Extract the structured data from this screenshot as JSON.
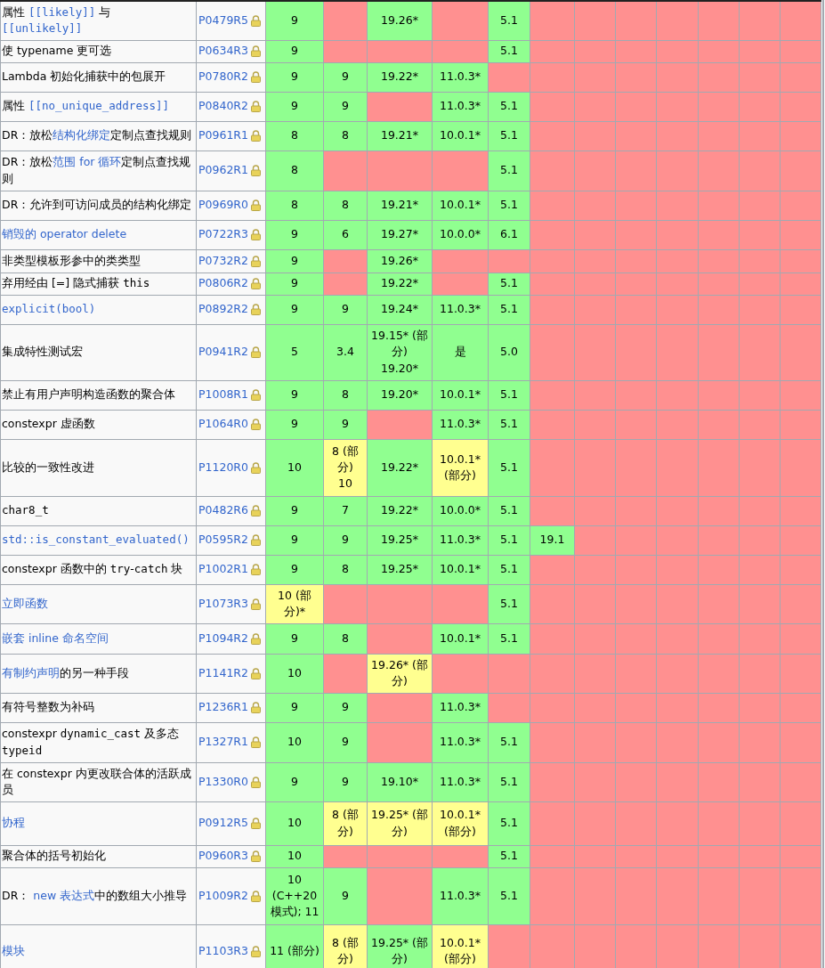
{
  "rows": [
    {
      "feature": [
        {
          "kind": "plain",
          "text": "属性 "
        },
        {
          "kind": "link-code",
          "text": "[[likely]]"
        },
        {
          "kind": "plain",
          "text": " 与 "
        },
        {
          "kind": "link-code",
          "text": "[[unlikely]]"
        }
      ],
      "paper": "P0479R5",
      "cells": [
        {
          "supported": true,
          "text": "9"
        },
        {
          "supported": false,
          "partial": false
        },
        {
          "supported": true,
          "text": "19.26*"
        },
        {
          "supported": false,
          "partial": false
        },
        {
          "supported": true,
          "text": "5.1"
        },
        {
          "supported": false,
          "partial": false
        },
        {
          "supported": false,
          "partial": false
        },
        {
          "supported": false,
          "partial": false
        },
        {
          "supported": false,
          "partial": false
        },
        {
          "supported": false,
          "partial": false
        },
        {
          "supported": false,
          "partial": false
        },
        {
          "supported": false,
          "partial": false
        }
      ]
    },
    {
      "feature": [
        {
          "kind": "plain",
          "text": "使 typename 更可选"
        }
      ],
      "paper": "P0634R3",
      "cells": [
        {
          "supported": true,
          "text": "9"
        },
        {
          "supported": false,
          "partial": false
        },
        {
          "supported": false,
          "partial": false
        },
        {
          "supported": false,
          "partial": false
        },
        {
          "supported": true,
          "text": "5.1"
        },
        {
          "supported": false,
          "partial": false
        },
        {
          "supported": false,
          "partial": false
        },
        {
          "supported": false,
          "partial": false
        },
        {
          "supported": false,
          "partial": false
        },
        {
          "supported": false,
          "partial": false
        },
        {
          "supported": false,
          "partial": false
        },
        {
          "supported": false,
          "partial": false
        }
      ]
    },
    {
      "feature": [
        {
          "kind": "plain",
          "text": "Lambda 初始化捕获中的包展开"
        }
      ],
      "paper": "P0780R2",
      "cells": [
        {
          "supported": true,
          "text": "9"
        },
        {
          "supported": true,
          "text": "9"
        },
        {
          "supported": true,
          "text": "19.22*"
        },
        {
          "supported": true,
          "text": "11.0.3*"
        },
        {
          "supported": false,
          "partial": false
        },
        {
          "supported": false,
          "partial": false
        },
        {
          "supported": false,
          "partial": false
        },
        {
          "supported": false,
          "partial": false
        },
        {
          "supported": false,
          "partial": false
        },
        {
          "supported": false,
          "partial": false
        },
        {
          "supported": false,
          "partial": false
        },
        {
          "supported": false,
          "partial": false
        }
      ]
    },
    {
      "feature": [
        {
          "kind": "plain",
          "text": "属性 "
        },
        {
          "kind": "link-code",
          "text": "[[no_unique_address]]"
        }
      ],
      "paper": "P0840R2",
      "cells": [
        {
          "supported": true,
          "text": "9"
        },
        {
          "supported": true,
          "text": "9"
        },
        {
          "supported": false,
          "partial": false
        },
        {
          "supported": true,
          "text": "11.0.3*"
        },
        {
          "supported": true,
          "text": "5.1"
        },
        {
          "supported": false,
          "partial": false
        },
        {
          "supported": false,
          "partial": false
        },
        {
          "supported": false,
          "partial": false
        },
        {
          "supported": false,
          "partial": false
        },
        {
          "supported": false,
          "partial": false
        },
        {
          "supported": false,
          "partial": false
        },
        {
          "supported": false,
          "partial": false
        }
      ]
    },
    {
      "feature": [
        {
          "kind": "plain",
          "text": "DR：放松"
        },
        {
          "kind": "link",
          "text": "结构化绑定"
        },
        {
          "kind": "plain",
          "text": "定制点查找规则"
        }
      ],
      "paper": "P0961R1",
      "cells": [
        {
          "supported": true,
          "text": "8"
        },
        {
          "supported": true,
          "text": "8"
        },
        {
          "supported": true,
          "text": "19.21*"
        },
        {
          "supported": true,
          "text": "10.0.1*"
        },
        {
          "supported": true,
          "text": "5.1"
        },
        {
          "supported": false,
          "partial": false
        },
        {
          "supported": false,
          "partial": false
        },
        {
          "supported": false,
          "partial": false
        },
        {
          "supported": false,
          "partial": false
        },
        {
          "supported": false,
          "partial": false
        },
        {
          "supported": false,
          "partial": false
        },
        {
          "supported": false,
          "partial": false
        }
      ]
    },
    {
      "feature": [
        {
          "kind": "plain",
          "text": "DR：放松"
        },
        {
          "kind": "link",
          "text": "范围 for 循环"
        },
        {
          "kind": "plain",
          "text": "定制点查找规则"
        }
      ],
      "paper": "P0962R1",
      "cells": [
        {
          "supported": true,
          "text": "8"
        },
        {
          "supported": false,
          "partial": false
        },
        {
          "supported": false,
          "partial": false
        },
        {
          "supported": false,
          "partial": false
        },
        {
          "supported": true,
          "text": "5.1"
        },
        {
          "supported": false,
          "partial": false
        },
        {
          "supported": false,
          "partial": false
        },
        {
          "supported": false,
          "partial": false
        },
        {
          "supported": false,
          "partial": false
        },
        {
          "supported": false,
          "partial": false
        },
        {
          "supported": false,
          "partial": false
        },
        {
          "supported": false,
          "partial": false
        }
      ]
    },
    {
      "feature": [
        {
          "kind": "plain",
          "text": "DR：允许到可访问成员的结构化绑定"
        }
      ],
      "paper": "P0969R0",
      "cells": [
        {
          "supported": true,
          "text": "8"
        },
        {
          "supported": true,
          "text": "8"
        },
        {
          "supported": true,
          "text": "19.21*"
        },
        {
          "supported": true,
          "text": "10.0.1*"
        },
        {
          "supported": true,
          "text": "5.1"
        },
        {
          "supported": false,
          "partial": false
        },
        {
          "supported": false,
          "partial": false
        },
        {
          "supported": false,
          "partial": false
        },
        {
          "supported": false,
          "partial": false
        },
        {
          "supported": false,
          "partial": false
        },
        {
          "supported": false,
          "partial": false
        },
        {
          "supported": false,
          "partial": false
        }
      ]
    },
    {
      "feature": [
        {
          "kind": "link",
          "text": "销毁的 operator delete"
        }
      ],
      "paper": "P0722R3",
      "cells": [
        {
          "supported": true,
          "text": "9"
        },
        {
          "supported": true,
          "text": "6"
        },
        {
          "supported": true,
          "text": "19.27*"
        },
        {
          "supported": true,
          "text": "10.0.0*"
        },
        {
          "supported": true,
          "text": "6.1"
        },
        {
          "supported": false,
          "partial": false
        },
        {
          "supported": false,
          "partial": false
        },
        {
          "supported": false,
          "partial": false
        },
        {
          "supported": false,
          "partial": false
        },
        {
          "supported": false,
          "partial": false
        },
        {
          "supported": false,
          "partial": false
        },
        {
          "supported": false,
          "partial": false
        }
      ]
    },
    {
      "feature": [
        {
          "kind": "plain",
          "text": "非类型模板形参中的类类型"
        }
      ],
      "paper": "P0732R2",
      "cells": [
        {
          "supported": true,
          "text": "9"
        },
        {
          "supported": false,
          "partial": false
        },
        {
          "supported": true,
          "text": "19.26*"
        },
        {
          "supported": false,
          "partial": false
        },
        {
          "supported": false,
          "partial": false
        },
        {
          "supported": false,
          "partial": false
        },
        {
          "supported": false,
          "partial": false
        },
        {
          "supported": false,
          "partial": false
        },
        {
          "supported": false,
          "partial": false
        },
        {
          "supported": false,
          "partial": false
        },
        {
          "supported": false,
          "partial": false
        },
        {
          "supported": false,
          "partial": false
        }
      ]
    },
    {
      "feature": [
        {
          "kind": "plain",
          "text": "弃用经由 [=] 隐式捕获 "
        },
        {
          "kind": "code",
          "text": "this"
        }
      ],
      "paper": "P0806R2",
      "cells": [
        {
          "supported": true,
          "text": "9"
        },
        {
          "supported": false,
          "partial": false
        },
        {
          "supported": true,
          "text": "19.22*"
        },
        {
          "supported": false,
          "partial": false
        },
        {
          "supported": true,
          "text": "5.1"
        },
        {
          "supported": false,
          "partial": false
        },
        {
          "supported": false,
          "partial": false
        },
        {
          "supported": false,
          "partial": false
        },
        {
          "supported": false,
          "partial": false
        },
        {
          "supported": false,
          "partial": false
        },
        {
          "supported": false,
          "partial": false
        },
        {
          "supported": false,
          "partial": false
        }
      ]
    },
    {
      "feature": [
        {
          "kind": "link-code",
          "text": "explicit(bool)"
        }
      ],
      "paper": "P0892R2",
      "cells": [
        {
          "supported": true,
          "text": "9"
        },
        {
          "supported": true,
          "text": "9"
        },
        {
          "supported": true,
          "text": "19.24*"
        },
        {
          "supported": true,
          "text": "11.0.3*"
        },
        {
          "supported": true,
          "text": "5.1"
        },
        {
          "supported": false,
          "partial": false
        },
        {
          "supported": false,
          "partial": false
        },
        {
          "supported": false,
          "partial": false
        },
        {
          "supported": false,
          "partial": false
        },
        {
          "supported": false,
          "partial": false
        },
        {
          "supported": false,
          "partial": false
        },
        {
          "supported": false,
          "partial": false
        }
      ]
    },
    {
      "feature": [
        {
          "kind": "plain",
          "text": "集成特性测试宏"
        }
      ],
      "paper": "P0941R2",
      "cells": [
        {
          "supported": true,
          "text": "5"
        },
        {
          "supported": true,
          "text": "3.4"
        },
        {
          "supported": true,
          "text": "19.15* (部分)\n19.20*"
        },
        {
          "supported": true,
          "text": "是"
        },
        {
          "supported": true,
          "text": "5.0"
        },
        {
          "supported": false,
          "partial": false
        },
        {
          "supported": false,
          "partial": false
        },
        {
          "supported": false,
          "partial": false
        },
        {
          "supported": false,
          "partial": false
        },
        {
          "supported": false,
          "partial": false
        },
        {
          "supported": false,
          "partial": false
        },
        {
          "supported": false,
          "partial": false
        }
      ]
    },
    {
      "feature": [
        {
          "kind": "plain",
          "text": "禁止有用户声明构造函数的聚合体"
        }
      ],
      "paper": "P1008R1",
      "cells": [
        {
          "supported": true,
          "text": "9"
        },
        {
          "supported": true,
          "text": "8"
        },
        {
          "supported": true,
          "text": "19.20*"
        },
        {
          "supported": true,
          "text": "10.0.1*"
        },
        {
          "supported": true,
          "text": "5.1"
        },
        {
          "supported": false,
          "partial": false
        },
        {
          "supported": false,
          "partial": false
        },
        {
          "supported": false,
          "partial": false
        },
        {
          "supported": false,
          "partial": false
        },
        {
          "supported": false,
          "partial": false
        },
        {
          "supported": false,
          "partial": false
        },
        {
          "supported": false,
          "partial": false
        }
      ]
    },
    {
      "feature": [
        {
          "kind": "plain",
          "text": "constexpr 虚函数"
        }
      ],
      "paper": "P1064R0",
      "cells": [
        {
          "supported": true,
          "text": "9"
        },
        {
          "supported": true,
          "text": "9"
        },
        {
          "supported": false,
          "partial": false
        },
        {
          "supported": true,
          "text": "11.0.3*"
        },
        {
          "supported": true,
          "text": "5.1"
        },
        {
          "supported": false,
          "partial": false
        },
        {
          "supported": false,
          "partial": false
        },
        {
          "supported": false,
          "partial": false
        },
        {
          "supported": false,
          "partial": false
        },
        {
          "supported": false,
          "partial": false
        },
        {
          "supported": false,
          "partial": false
        },
        {
          "supported": false,
          "partial": false
        }
      ]
    },
    {
      "feature": [
        {
          "kind": "plain",
          "text": "比较的一致性改进"
        }
      ],
      "paper": "P1120R0",
      "cells": [
        {
          "supported": true,
          "text": "10"
        },
        {
          "supported": false,
          "partial": true,
          "text": "8 (部分)\n10"
        },
        {
          "supported": true,
          "text": "19.22*"
        },
        {
          "supported": false,
          "partial": true,
          "text": "10.0.1* (部分)"
        },
        {
          "supported": true,
          "text": "5.1"
        },
        {
          "supported": false,
          "partial": false
        },
        {
          "supported": false,
          "partial": false
        },
        {
          "supported": false,
          "partial": false
        },
        {
          "supported": false,
          "partial": false
        },
        {
          "supported": false,
          "partial": false
        },
        {
          "supported": false,
          "partial": false
        },
        {
          "supported": false,
          "partial": false
        }
      ]
    },
    {
      "feature": [
        {
          "kind": "code",
          "text": "char8_t"
        }
      ],
      "paper": "P0482R6",
      "cells": [
        {
          "supported": true,
          "text": "9"
        },
        {
          "supported": true,
          "text": "7"
        },
        {
          "supported": true,
          "text": "19.22*"
        },
        {
          "supported": true,
          "text": "10.0.0*"
        },
        {
          "supported": true,
          "text": "5.1"
        },
        {
          "supported": false,
          "partial": false
        },
        {
          "supported": false,
          "partial": false
        },
        {
          "supported": false,
          "partial": false
        },
        {
          "supported": false,
          "partial": false
        },
        {
          "supported": false,
          "partial": false
        },
        {
          "supported": false,
          "partial": false
        },
        {
          "supported": false,
          "partial": false
        }
      ]
    },
    {
      "feature": [
        {
          "kind": "link-code",
          "text": "std::is_constant_evaluated()"
        }
      ],
      "paper": "P0595R2",
      "cells": [
        {
          "supported": true,
          "text": "9"
        },
        {
          "supported": true,
          "text": "9"
        },
        {
          "supported": true,
          "text": "19.25*"
        },
        {
          "supported": true,
          "text": "11.0.3*"
        },
        {
          "supported": true,
          "text": "5.1"
        },
        {
          "supported": true,
          "text": "19.1"
        },
        {
          "supported": false,
          "partial": false
        },
        {
          "supported": false,
          "partial": false
        },
        {
          "supported": false,
          "partial": false
        },
        {
          "supported": false,
          "partial": false
        },
        {
          "supported": false,
          "partial": false
        },
        {
          "supported": false,
          "partial": false
        }
      ]
    },
    {
      "feature": [
        {
          "kind": "plain",
          "text": "constexpr 函数中的 "
        },
        {
          "kind": "code",
          "text": "try"
        },
        {
          "kind": "plain",
          "text": "-"
        },
        {
          "kind": "code",
          "text": "catch"
        },
        {
          "kind": "plain",
          "text": " 块"
        }
      ],
      "paper": "P1002R1",
      "cells": [
        {
          "supported": true,
          "text": "9"
        },
        {
          "supported": true,
          "text": "8"
        },
        {
          "supported": true,
          "text": "19.25*"
        },
        {
          "supported": true,
          "text": "10.0.1*"
        },
        {
          "supported": true,
          "text": "5.1"
        },
        {
          "supported": false,
          "partial": false
        },
        {
          "supported": false,
          "partial": false
        },
        {
          "supported": false,
          "partial": false
        },
        {
          "supported": false,
          "partial": false
        },
        {
          "supported": false,
          "partial": false
        },
        {
          "supported": false,
          "partial": false
        },
        {
          "supported": false,
          "partial": false
        }
      ]
    },
    {
      "feature": [
        {
          "kind": "link",
          "text": "立即函数"
        }
      ],
      "paper": "P1073R3",
      "cells": [
        {
          "supported": false,
          "partial": true,
          "text": "10 (部分)*"
        },
        {
          "supported": false,
          "partial": false
        },
        {
          "supported": false,
          "partial": false
        },
        {
          "supported": false,
          "partial": false
        },
        {
          "supported": true,
          "text": "5.1"
        },
        {
          "supported": false,
          "partial": false
        },
        {
          "supported": false,
          "partial": false
        },
        {
          "supported": false,
          "partial": false
        },
        {
          "supported": false,
          "partial": false
        },
        {
          "supported": false,
          "partial": false
        },
        {
          "supported": false,
          "partial": false
        },
        {
          "supported": false,
          "partial": false
        }
      ]
    },
    {
      "feature": [
        {
          "kind": "link",
          "text": "嵌套 inline 命名空间"
        }
      ],
      "paper": "P1094R2",
      "cells": [
        {
          "supported": true,
          "text": "9"
        },
        {
          "supported": true,
          "text": "8"
        },
        {
          "supported": false,
          "partial": false
        },
        {
          "supported": true,
          "text": "10.0.1*"
        },
        {
          "supported": true,
          "text": "5.1"
        },
        {
          "supported": false,
          "partial": false
        },
        {
          "supported": false,
          "partial": false
        },
        {
          "supported": false,
          "partial": false
        },
        {
          "supported": false,
          "partial": false
        },
        {
          "supported": false,
          "partial": false
        },
        {
          "supported": false,
          "partial": false
        },
        {
          "supported": false,
          "partial": false
        }
      ]
    },
    {
      "feature": [
        {
          "kind": "link",
          "text": "有制约声明"
        },
        {
          "kind": "plain",
          "text": "的另一种手段"
        }
      ],
      "paper": "P1141R2",
      "cells": [
        {
          "supported": true,
          "text": "10"
        },
        {
          "supported": false,
          "partial": false
        },
        {
          "supported": false,
          "partial": true,
          "text": "19.26* (部分)"
        },
        {
          "supported": false,
          "partial": false
        },
        {
          "supported": false,
          "partial": false
        },
        {
          "supported": false,
          "partial": false
        },
        {
          "supported": false,
          "partial": false
        },
        {
          "supported": false,
          "partial": false
        },
        {
          "supported": false,
          "partial": false
        },
        {
          "supported": false,
          "partial": false
        },
        {
          "supported": false,
          "partial": false
        },
        {
          "supported": false,
          "partial": false
        }
      ]
    },
    {
      "feature": [
        {
          "kind": "plain",
          "text": "有符号整数为补码"
        }
      ],
      "paper": "P1236R1",
      "cells": [
        {
          "supported": true,
          "text": "9"
        },
        {
          "supported": true,
          "text": "9"
        },
        {
          "supported": false,
          "partial": false
        },
        {
          "supported": true,
          "text": "11.0.3*"
        },
        {
          "supported": false,
          "partial": false
        },
        {
          "supported": false,
          "partial": false
        },
        {
          "supported": false,
          "partial": false
        },
        {
          "supported": false,
          "partial": false
        },
        {
          "supported": false,
          "partial": false
        },
        {
          "supported": false,
          "partial": false
        },
        {
          "supported": false,
          "partial": false
        },
        {
          "supported": false,
          "partial": false
        }
      ]
    },
    {
      "feature": [
        {
          "kind": "plain",
          "text": "constexpr "
        },
        {
          "kind": "code",
          "text": "dynamic_cast"
        },
        {
          "kind": "plain",
          "text": " 及多态 "
        },
        {
          "kind": "code",
          "text": "typeid"
        }
      ],
      "paper": "P1327R1",
      "cells": [
        {
          "supported": true,
          "text": "10"
        },
        {
          "supported": true,
          "text": "9"
        },
        {
          "supported": false,
          "partial": false
        },
        {
          "supported": true,
          "text": "11.0.3*"
        },
        {
          "supported": true,
          "text": "5.1"
        },
        {
          "supported": false,
          "partial": false
        },
        {
          "supported": false,
          "partial": false
        },
        {
          "supported": false,
          "partial": false
        },
        {
          "supported": false,
          "partial": false
        },
        {
          "supported": false,
          "partial": false
        },
        {
          "supported": false,
          "partial": false
        },
        {
          "supported": false,
          "partial": false
        }
      ]
    },
    {
      "feature": [
        {
          "kind": "plain",
          "text": "在 constexpr 内更改联合体的活跃成员"
        }
      ],
      "paper": "P1330R0",
      "cells": [
        {
          "supported": true,
          "text": "9"
        },
        {
          "supported": true,
          "text": "9"
        },
        {
          "supported": true,
          "text": "19.10*"
        },
        {
          "supported": true,
          "text": "11.0.3*"
        },
        {
          "supported": true,
          "text": "5.1"
        },
        {
          "supported": false,
          "partial": false
        },
        {
          "supported": false,
          "partial": false
        },
        {
          "supported": false,
          "partial": false
        },
        {
          "supported": false,
          "partial": false
        },
        {
          "supported": false,
          "partial": false
        },
        {
          "supported": false,
          "partial": false
        },
        {
          "supported": false,
          "partial": false
        }
      ]
    },
    {
      "feature": [
        {
          "kind": "link",
          "text": "协程"
        }
      ],
      "paper": "P0912R5",
      "cells": [
        {
          "supported": true,
          "text": "10"
        },
        {
          "supported": false,
          "partial": true,
          "text": "8 (部分)"
        },
        {
          "supported": false,
          "partial": true,
          "text": "19.25* (部分)"
        },
        {
          "supported": false,
          "partial": true,
          "text": "10.0.1* (部分)"
        },
        {
          "supported": true,
          "text": "5.1"
        },
        {
          "supported": false,
          "partial": false
        },
        {
          "supported": false,
          "partial": false
        },
        {
          "supported": false,
          "partial": false
        },
        {
          "supported": false,
          "partial": false
        },
        {
          "supported": false,
          "partial": false
        },
        {
          "supported": false,
          "partial": false
        },
        {
          "supported": false,
          "partial": false
        }
      ]
    },
    {
      "feature": [
        {
          "kind": "plain",
          "text": "聚合体的括号初始化"
        }
      ],
      "paper": "P0960R3",
      "cells": [
        {
          "supported": true,
          "text": "10"
        },
        {
          "supported": false,
          "partial": false
        },
        {
          "supported": false,
          "partial": false
        },
        {
          "supported": false,
          "partial": false
        },
        {
          "supported": true,
          "text": "5.1"
        },
        {
          "supported": false,
          "partial": false
        },
        {
          "supported": false,
          "partial": false
        },
        {
          "supported": false,
          "partial": false
        },
        {
          "supported": false,
          "partial": false
        },
        {
          "supported": false,
          "partial": false
        },
        {
          "supported": false,
          "partial": false
        },
        {
          "supported": false,
          "partial": false
        }
      ]
    },
    {
      "feature": [
        {
          "kind": "plain",
          "text": "DR： "
        },
        {
          "kind": "link",
          "text": "new 表达式"
        },
        {
          "kind": "plain",
          "text": "中的数组大小推导"
        }
      ],
      "paper": "P1009R2",
      "cells": [
        {
          "supported": true,
          "text": "10\n(C++20\n模式); 11"
        },
        {
          "supported": true,
          "text": "9"
        },
        {
          "supported": false,
          "partial": false
        },
        {
          "supported": true,
          "text": "11.0.3*"
        },
        {
          "supported": true,
          "text": "5.1"
        },
        {
          "supported": false,
          "partial": false
        },
        {
          "supported": false,
          "partial": false
        },
        {
          "supported": false,
          "partial": false
        },
        {
          "supported": false,
          "partial": false
        },
        {
          "supported": false,
          "partial": false
        },
        {
          "supported": false,
          "partial": false
        },
        {
          "supported": false,
          "partial": false
        }
      ]
    },
    {
      "feature": [
        {
          "kind": "link",
          "text": "模块"
        }
      ],
      "paper": "P1103R3",
      "cells": [
        {
          "supported": true,
          "text": "11 (部分)"
        },
        {
          "supported": false,
          "partial": true,
          "text": "8 (部分)"
        },
        {
          "supported": true,
          "text": "19.25* (部分)"
        },
        {
          "supported": false,
          "partial": true,
          "text": "10.0.1* (部分)"
        },
        {
          "supported": false,
          "partial": false
        },
        {
          "supported": false,
          "partial": false
        },
        {
          "supported": false,
          "partial": false
        },
        {
          "supported": false,
          "partial": false
        },
        {
          "supported": false,
          "partial": false
        },
        {
          "supported": false,
          "partial": false
        },
        {
          "supported": false,
          "partial": false
        },
        {
          "supported": false,
          "partial": false
        }
      ]
    }
  ]
}
